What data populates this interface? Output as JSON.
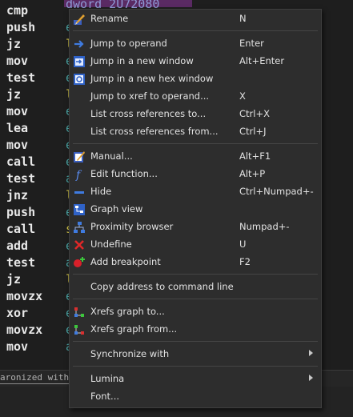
{
  "disasm": {
    "top_operand": "dword_2U72080",
    "rows": [
      {
        "mnemonic": "cmp",
        "operand": ""
      },
      {
        "mnemonic": "push",
        "operand": "e"
      },
      {
        "mnemonic": "jz",
        "operand": "l"
      },
      {
        "mnemonic": "mov",
        "operand": "e"
      },
      {
        "mnemonic": "test",
        "operand": "e"
      },
      {
        "mnemonic": "jz",
        "operand": "l"
      },
      {
        "mnemonic": "mov",
        "operand": "e"
      },
      {
        "mnemonic": "lea",
        "operand": "e"
      },
      {
        "mnemonic": "mov",
        "operand": "e"
      },
      {
        "mnemonic": "call",
        "operand": "e"
      },
      {
        "mnemonic": "test",
        "operand": "a"
      },
      {
        "mnemonic": "jnz",
        "operand": "l"
      },
      {
        "mnemonic": "push",
        "operand": "e"
      },
      {
        "mnemonic": "call",
        "operand": "s"
      },
      {
        "mnemonic": "add",
        "operand": "e"
      },
      {
        "mnemonic": "test",
        "operand": "a"
      },
      {
        "mnemonic": "jz",
        "operand": "l"
      },
      {
        "mnemonic": "movzx",
        "operand": "e"
      },
      {
        "mnemonic": "xor",
        "operand": "e"
      },
      {
        "mnemonic": "movzx",
        "operand": "e"
      },
      {
        "mnemonic": "mov",
        "operand": "a"
      }
    ]
  },
  "status": {
    "text": "aronized with"
  },
  "menu": {
    "items": [
      {
        "label": "Rename",
        "shortcut": "N",
        "icon": "rename-icon"
      },
      {
        "label": "Jump to operand",
        "shortcut": "Enter",
        "icon": "jump-operand-icon"
      },
      {
        "label": "Jump in a new window",
        "shortcut": "Alt+Enter",
        "icon": "new-window-icon"
      },
      {
        "label": "Jump in a new hex window",
        "shortcut": "",
        "icon": "hex-window-icon"
      },
      {
        "label": "Jump to xref to operand...",
        "shortcut": "X",
        "icon": ""
      },
      {
        "label": "List cross references to...",
        "shortcut": "Ctrl+X",
        "icon": ""
      },
      {
        "label": "List cross references from...",
        "shortcut": "Ctrl+J",
        "icon": ""
      },
      {
        "label": "Manual...",
        "shortcut": "Alt+F1",
        "icon": "manual-icon"
      },
      {
        "label": "Edit function...",
        "shortcut": "Alt+P",
        "icon": "function-icon"
      },
      {
        "label": "Hide",
        "shortcut": "Ctrl+Numpad+-",
        "icon": "hide-icon"
      },
      {
        "label": "Graph view",
        "shortcut": "",
        "icon": "graph-view-icon"
      },
      {
        "label": "Proximity browser",
        "shortcut": "Numpad+-",
        "icon": "proximity-icon"
      },
      {
        "label": "Undefine",
        "shortcut": "U",
        "icon": "undefine-icon"
      },
      {
        "label": "Add breakpoint",
        "shortcut": "F2",
        "icon": "breakpoint-icon"
      },
      {
        "label": "Copy address to command line",
        "shortcut": "",
        "icon": ""
      },
      {
        "label": "Xrefs graph to...",
        "shortcut": "",
        "icon": "xrefs-to-icon"
      },
      {
        "label": "Xrefs graph from...",
        "shortcut": "",
        "icon": "xrefs-from-icon"
      },
      {
        "label": "Synchronize with",
        "shortcut": "",
        "icon": ""
      },
      {
        "label": "Lumina",
        "shortcut": "",
        "icon": ""
      },
      {
        "label": "Font...",
        "shortcut": "",
        "icon": ""
      }
    ]
  },
  "colors": {
    "operand_e": "#4aa3a3",
    "operand_l": "#d6c84a",
    "operand_s": "#d6c84a",
    "operand_a": "#4aa3a3",
    "top_operand": "#8f9ad6"
  }
}
